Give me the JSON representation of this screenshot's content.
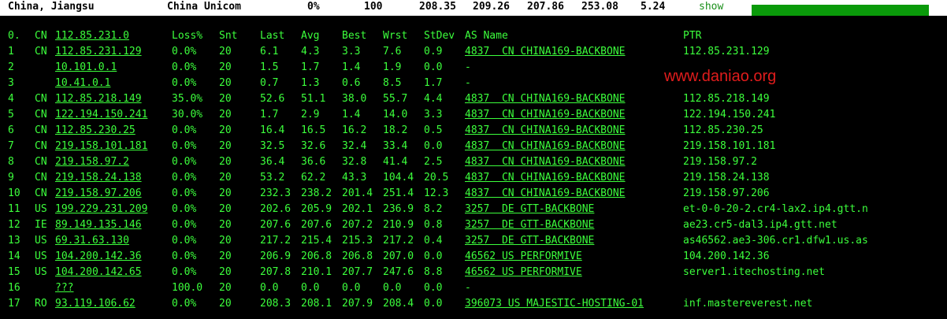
{
  "topbar": {
    "location": "China, Jiangsu",
    "isp": "China Unicom",
    "loss": "0%",
    "count": "100",
    "last": "208.35",
    "avg": "209.26",
    "best": "207.86",
    "worst": "253.08",
    "stdev": "5.24",
    "show_label": "show",
    "progress_fraction": 1.0
  },
  "watermark": "www.daniao.org",
  "headers": {
    "hop": "0.",
    "cc": "CN",
    "host": "112.85.231.0",
    "loss": "Loss%",
    "snt": "Snt",
    "last": "Last",
    "avg": "Avg",
    "best": "Best",
    "wrst": "Wrst",
    "stdev": "StDev",
    "as": "AS Name",
    "ptr": "PTR"
  },
  "rows": [
    {
      "hop": "1",
      "cc": "CN",
      "host": "112.85.231.129",
      "loss": "0.0%",
      "snt": "20",
      "last": "6.1",
      "avg": "4.3",
      "best": "3.3",
      "wrst": "7.6",
      "stdev": "0.9",
      "as": "4837  CN CHINA169-BACKBONE",
      "ptr": "112.85.231.129"
    },
    {
      "hop": "2",
      "cc": "",
      "host": "10.101.0.1",
      "loss": "0.0%",
      "snt": "20",
      "last": "1.5",
      "avg": "1.7",
      "best": "1.4",
      "wrst": "1.9",
      "stdev": "0.0",
      "as": "-",
      "ptr": ""
    },
    {
      "hop": "3",
      "cc": "",
      "host": "10.41.0.1",
      "loss": "0.0%",
      "snt": "20",
      "last": "0.7",
      "avg": "1.3",
      "best": "0.6",
      "wrst": "8.5",
      "stdev": "1.7",
      "as": "-",
      "ptr": ""
    },
    {
      "hop": "4",
      "cc": "CN",
      "host": "112.85.218.149",
      "loss": "35.0%",
      "snt": "20",
      "last": "52.6",
      "avg": "51.1",
      "best": "38.0",
      "wrst": "55.7",
      "stdev": "4.4",
      "as": "4837  CN CHINA169-BACKBONE",
      "ptr": "112.85.218.149"
    },
    {
      "hop": "5",
      "cc": "CN",
      "host": "122.194.150.241",
      "loss": "30.0%",
      "snt": "20",
      "last": "1.7",
      "avg": "2.9",
      "best": "1.4",
      "wrst": "14.0",
      "stdev": "3.3",
      "as": "4837  CN CHINA169-BACKBONE",
      "ptr": "122.194.150.241"
    },
    {
      "hop": "6",
      "cc": "CN",
      "host": "112.85.230.25",
      "loss": "0.0%",
      "snt": "20",
      "last": "16.4",
      "avg": "16.5",
      "best": "16.2",
      "wrst": "18.2",
      "stdev": "0.5",
      "as": "4837  CN CHINA169-BACKBONE",
      "ptr": "112.85.230.25"
    },
    {
      "hop": "7",
      "cc": "CN",
      "host": "219.158.101.181",
      "loss": "0.0%",
      "snt": "20",
      "last": "32.5",
      "avg": "32.6",
      "best": "32.4",
      "wrst": "33.4",
      "stdev": "0.0",
      "as": "4837  CN CHINA169-BACKBONE",
      "ptr": "219.158.101.181"
    },
    {
      "hop": "8",
      "cc": "CN",
      "host": "219.158.97.2",
      "loss": "0.0%",
      "snt": "20",
      "last": "36.4",
      "avg": "36.6",
      "best": "32.8",
      "wrst": "41.4",
      "stdev": "2.5",
      "as": "4837  CN CHINA169-BACKBONE",
      "ptr": "219.158.97.2"
    },
    {
      "hop": "9",
      "cc": "CN",
      "host": "219.158.24.138",
      "loss": "0.0%",
      "snt": "20",
      "last": "53.2",
      "avg": "62.2",
      "best": "43.3",
      "wrst": "104.4",
      "stdev": "20.5",
      "as": "4837  CN CHINA169-BACKBONE",
      "ptr": "219.158.24.138"
    },
    {
      "hop": "10",
      "cc": "CN",
      "host": "219.158.97.206",
      "loss": "0.0%",
      "snt": "20",
      "last": "232.3",
      "avg": "238.2",
      "best": "201.4",
      "wrst": "251.4",
      "stdev": "12.3",
      "as": "4837  CN CHINA169-BACKBONE",
      "ptr": "219.158.97.206"
    },
    {
      "hop": "11",
      "cc": "US",
      "host": "199.229.231.209",
      "loss": "0.0%",
      "snt": "20",
      "last": "202.6",
      "avg": "205.9",
      "best": "202.1",
      "wrst": "236.9",
      "stdev": "8.2",
      "as": "3257  DE GTT-BACKBONE",
      "ptr": "et-0-0-20-2.cr4-lax2.ip4.gtt.n"
    },
    {
      "hop": "12",
      "cc": "IE",
      "host": "89.149.135.146",
      "loss": "0.0%",
      "snt": "20",
      "last": "207.6",
      "avg": "207.6",
      "best": "207.2",
      "wrst": "210.9",
      "stdev": "0.8",
      "as": "3257  DE GTT-BACKBONE",
      "ptr": "ae23.cr5-dal3.ip4.gtt.net"
    },
    {
      "hop": "13",
      "cc": "US",
      "host": "69.31.63.130",
      "loss": "0.0%",
      "snt": "20",
      "last": "217.2",
      "avg": "215.4",
      "best": "215.3",
      "wrst": "217.2",
      "stdev": "0.4",
      "as": "3257  DE GTT-BACKBONE",
      "ptr": "as46562.ae3-306.cr1.dfw1.us.as"
    },
    {
      "hop": "14",
      "cc": "US",
      "host": "104.200.142.36",
      "loss": "0.0%",
      "snt": "20",
      "last": "206.9",
      "avg": "206.8",
      "best": "206.8",
      "wrst": "207.0",
      "stdev": "0.0",
      "as": "46562 US PERFORMIVE",
      "ptr": "104.200.142.36"
    },
    {
      "hop": "15",
      "cc": "US",
      "host": "104.200.142.65",
      "loss": "0.0%",
      "snt": "20",
      "last": "207.8",
      "avg": "210.1",
      "best": "207.7",
      "wrst": "247.6",
      "stdev": "8.8",
      "as": "46562 US PERFORMIVE",
      "ptr": "server1.itechosting.net"
    },
    {
      "hop": "16",
      "cc": "",
      "host": "???",
      "loss": "100.0",
      "snt": "20",
      "last": "0.0",
      "avg": "0.0",
      "best": "0.0",
      "wrst": "0.0",
      "stdev": "0.0",
      "as": "-",
      "ptr": ""
    },
    {
      "hop": "17",
      "cc": "RO",
      "host": "93.119.106.62",
      "loss": "0.0%",
      "snt": "20",
      "last": "208.3",
      "avg": "208.1",
      "best": "207.9",
      "wrst": "208.4",
      "stdev": "0.0",
      "as": "396073 US MAJESTIC-HOSTING-01",
      "ptr": "inf.mastereverest.net"
    }
  ]
}
